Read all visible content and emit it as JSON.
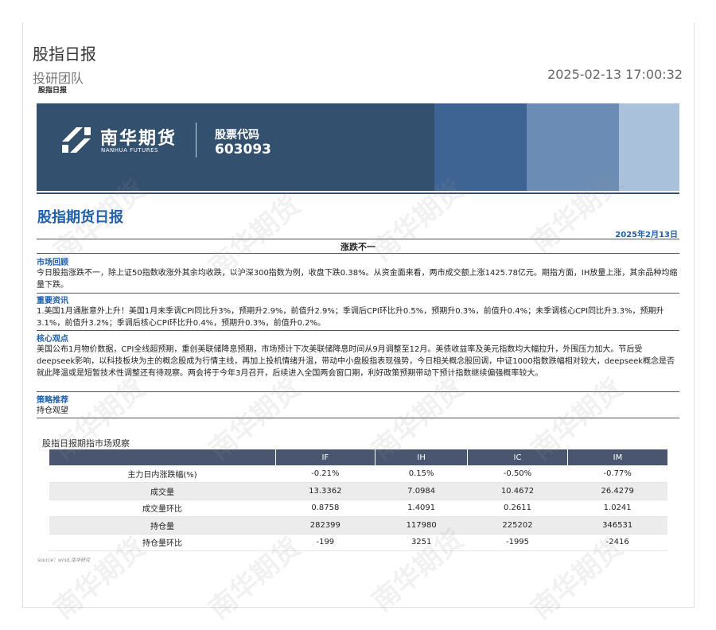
{
  "header": {
    "title": "股指日报",
    "team": "投研团队",
    "tag": "股指日报",
    "datetime": "2025-02-13 17:00:32"
  },
  "banner": {
    "company_cn": "南华期货",
    "company_en": "NANHUA FUTURES",
    "stock_label": "股票代码",
    "stock_code": "603093"
  },
  "report": {
    "title": "股指期货日报",
    "date": "2025年2月13日",
    "headline": "涨跌不一",
    "sections": [
      {
        "label": "市场回顾",
        "body": "今日股指涨跌不一，除上证50指数收涨外其余均收跌，以沪深300指数为例，收盘下跌0.38%。从资金面来看，两市成交额上涨1425.78亿元。期指方面，IH放量上涨，其余品种均缩量下跌。"
      },
      {
        "label": "重要资讯",
        "body": "1.美国1月通胀意外上升！美国1月未季调CPI同比升3%，预期升2.9%，前值升2.9%；季调后CPI环比升0.5%，预期升0.3%，前值升0.4%；未季调核心CPI同比升3.3%，预期升3.1%，前值升3.2%；季调后核心CPI环比升0.4%，预期升0.3%，前值升0.2%。"
      },
      {
        "label": "核心观点",
        "body": "美国公布1月物价数据，CPI全线超预期，重创美联储降息预期，市场预计下次美联储降息时间从9月调整至12月。美债收益率及美元指数均大幅拉升，外围压力加大。节后受deepseek影响，以科技板块为主的概念股成为行情主线，再加上投机情绪升温，带动中小盘股指表现强势，今日相关概念股回调，中证1000指数跌幅相对较大，deepseek概念是否就此降温或是短暂技术性调整还有待观察。两会将于今年3月召开，后续进入全国两会窗口期，利好政策预期带动下预计指数继续偏强概率较大。"
      },
      {
        "label": "策略推荐",
        "body": "持仓观望"
      }
    ]
  },
  "table": {
    "title": "股指日报期指市场观察",
    "columns": [
      "",
      "IF",
      "IH",
      "IC",
      "IM"
    ],
    "rows": [
      [
        "主力日内涨跌幅(%)",
        "-0.21%",
        "0.15%",
        "-0.50%",
        "-0.77%"
      ],
      [
        "成交量",
        "13.3362",
        "7.0984",
        "10.4672",
        "26.4279"
      ],
      [
        "成交量环比",
        "0.8758",
        "1.4091",
        "0.2611",
        "1.0241"
      ],
      [
        "持仓量",
        "282399",
        "117980",
        "225202",
        "346531"
      ],
      [
        "持仓量环比",
        "-199",
        "3251",
        "-1995",
        "-2416"
      ]
    ],
    "source": "source：wind,南华研究"
  },
  "watermark": "南华期货",
  "colors": {
    "brand_blue": "#1f5fa8",
    "banner_navy": "#34506f",
    "table_header": "#4a566f"
  }
}
